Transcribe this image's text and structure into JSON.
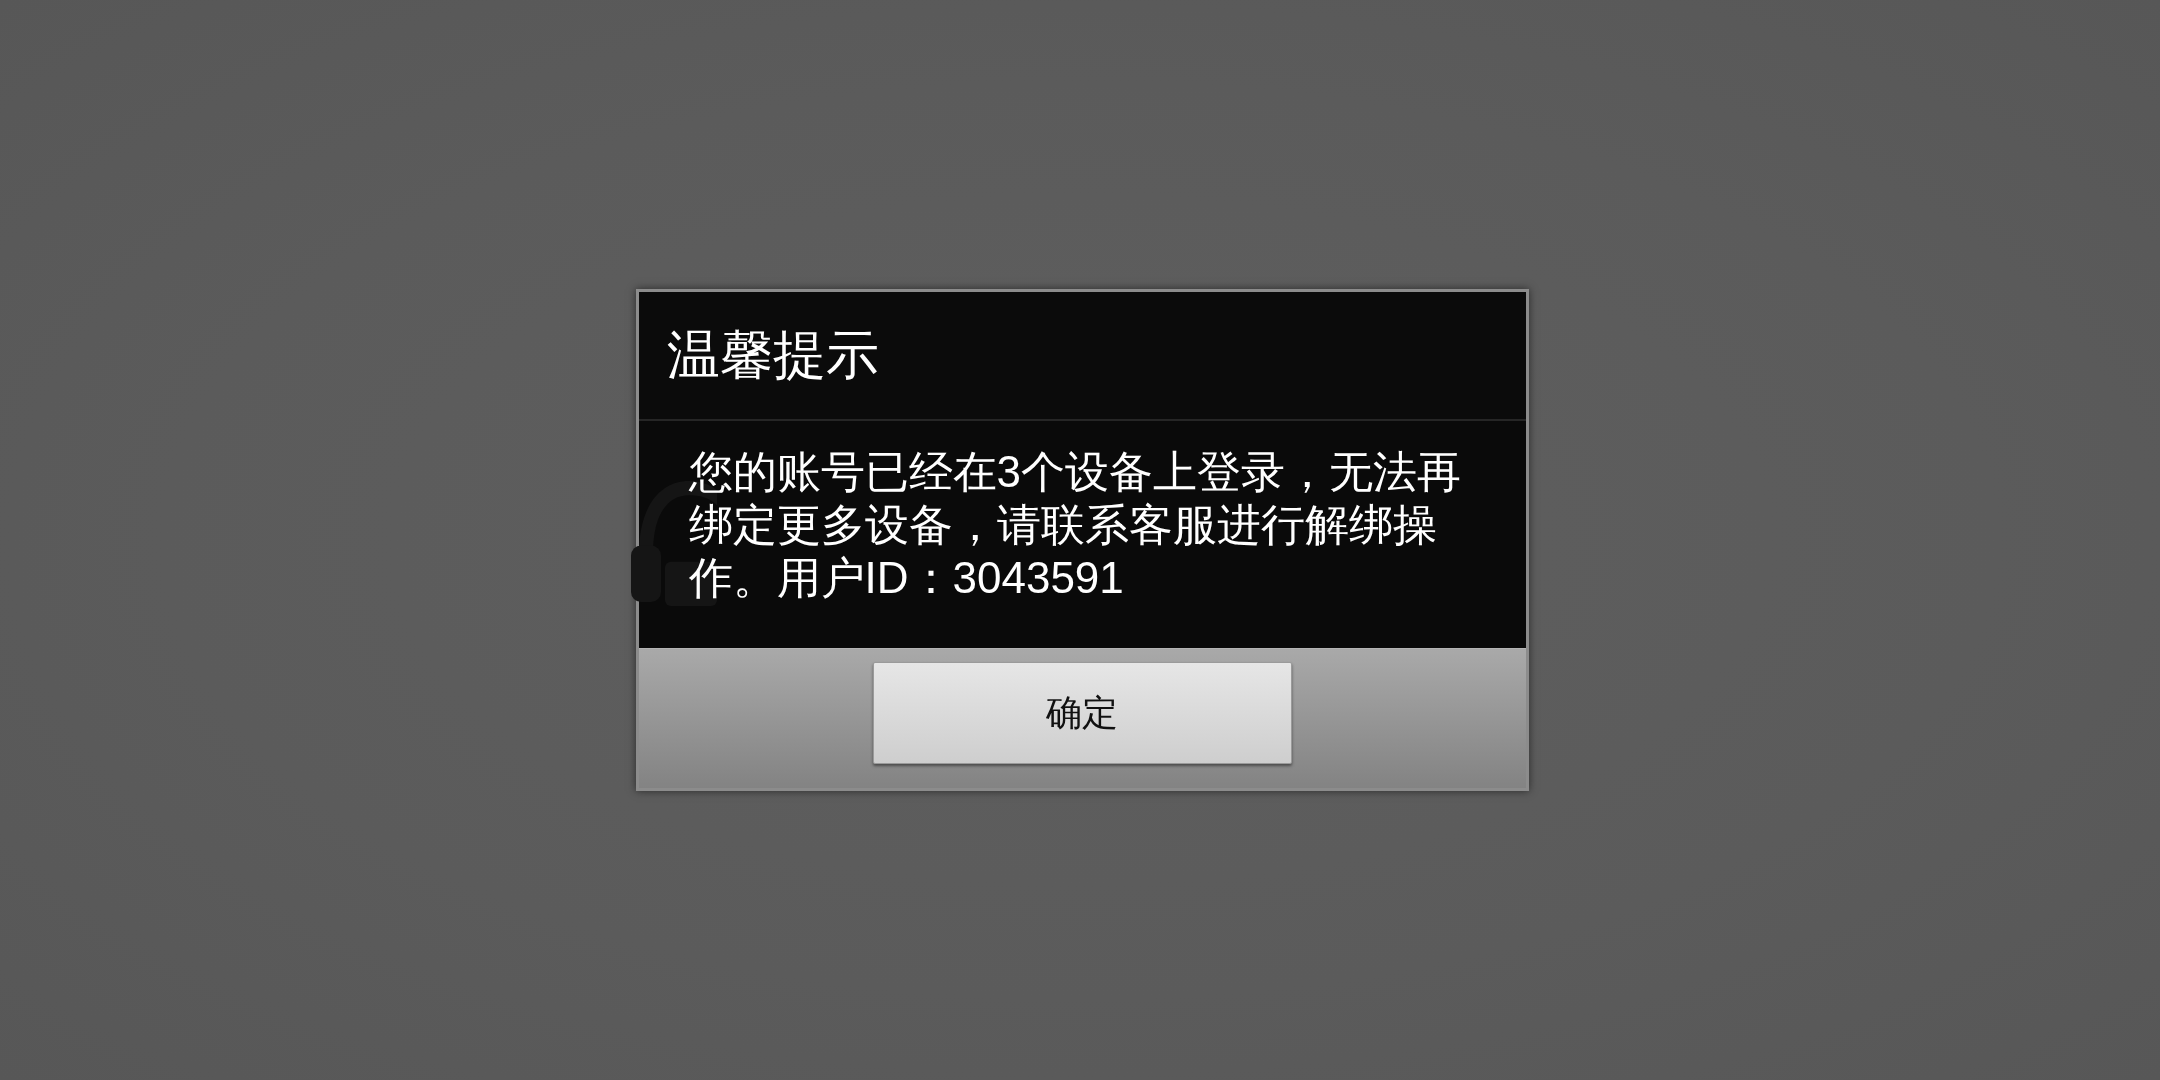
{
  "dialog": {
    "title": "温馨提示",
    "message": "您的账号已经在3个设备上登录，无法再绑定更多设备，请联系客服进行解绑操作。用户ID：3043591",
    "buttons": [
      {
        "label": "确定"
      }
    ]
  }
}
